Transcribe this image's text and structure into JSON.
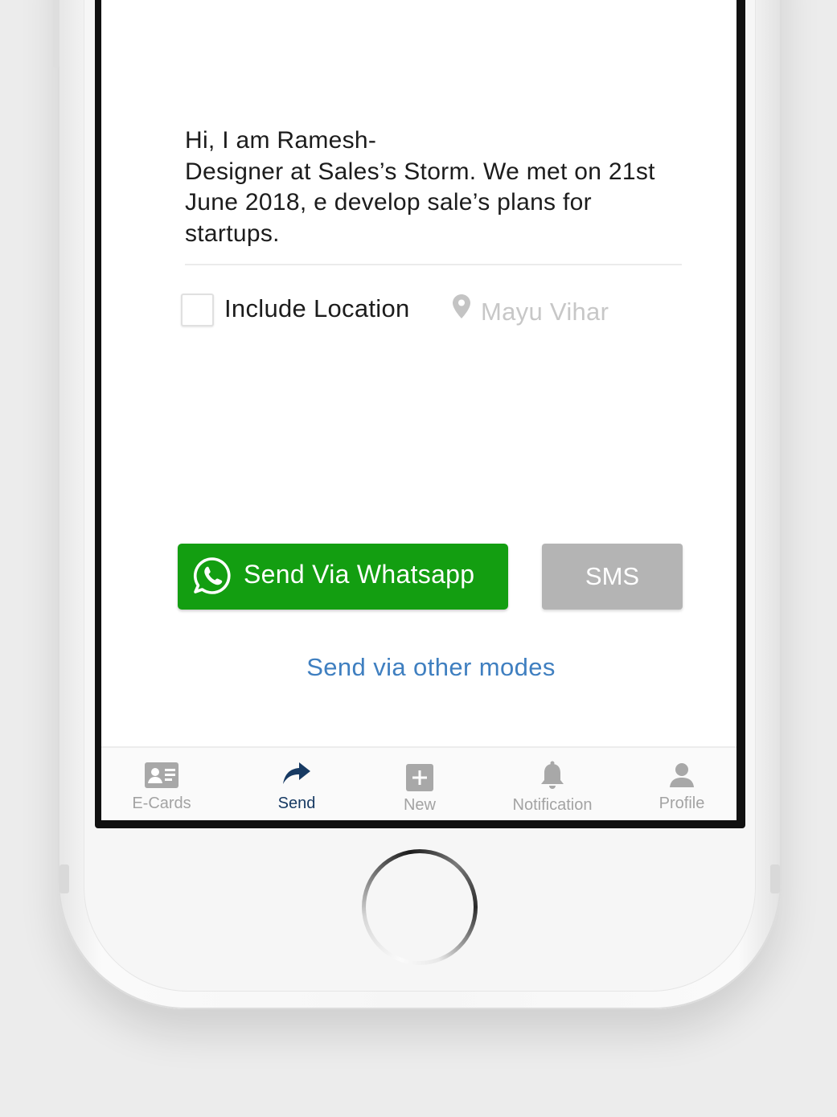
{
  "message": {
    "lines": [
      "Hi, I am Ramesh-",
      "Designer at Sales’s Storm. We met on 21st",
      "June 2018, e develop sale’s plans for",
      "startups."
    ]
  },
  "location": {
    "checkbox_label": "Include Location",
    "checked": false,
    "icon": "map-pin-icon",
    "value": "Mayu Vihar"
  },
  "actions": {
    "whatsapp_label": "Send Via Whatsapp",
    "whatsapp_icon": "whatsapp-icon",
    "sms_label": "SMS",
    "other_modes_label": "Send via other modes"
  },
  "tabbar": {
    "active": "Send",
    "items": [
      {
        "label": "E-Cards",
        "icon": "id-card-icon"
      },
      {
        "label": "Send",
        "icon": "share-arrow-icon"
      },
      {
        "label": "New",
        "icon": "plus-square-icon"
      },
      {
        "label": "Notification",
        "icon": "bell-icon"
      },
      {
        "label": "Profile",
        "icon": "person-icon"
      }
    ]
  },
  "colors": {
    "whatsapp_green": "#139e11",
    "sms_gray": "#b4b4b4",
    "link_blue": "#3f7fc0",
    "tab_active": "#173a63",
    "tab_inactive": "#a3a3a3"
  }
}
